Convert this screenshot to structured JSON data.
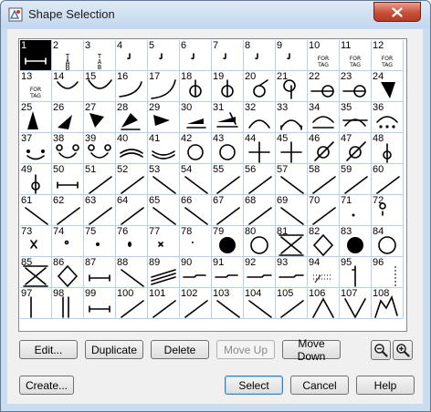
{
  "window": {
    "title": "Shape Selection",
    "close_icon": "close-icon",
    "app_icon": "shape-app-icon"
  },
  "shape_grid": {
    "selected_index": 0,
    "cells": [
      {
        "n": "1",
        "icon": "bar-end-caps"
      },
      {
        "n": "2",
        "icon": "text-tab"
      },
      {
        "n": "3",
        "icon": "text-tab-small"
      },
      {
        "n": "4",
        "icon": "small-note-tick"
      },
      {
        "n": "5",
        "icon": "small-note-tick"
      },
      {
        "n": "6",
        "icon": "small-note-tick"
      },
      {
        "n": "7",
        "icon": "small-note-tick"
      },
      {
        "n": "8",
        "icon": "small-note-tick"
      },
      {
        "n": "9",
        "icon": "small-note-tick"
      },
      {
        "n": "10",
        "icon": "for-tag-text"
      },
      {
        "n": "11",
        "icon": "for-tag-text"
      },
      {
        "n": "12",
        "icon": "for-tag-text"
      },
      {
        "n": "13",
        "icon": "for-tag-text"
      },
      {
        "n": "14",
        "icon": "arc-down-small"
      },
      {
        "n": "15",
        "icon": "arc-down-wide"
      },
      {
        "n": "16",
        "icon": "arc-quarter-left"
      },
      {
        "n": "17",
        "icon": "arc-quarter-right"
      },
      {
        "n": "18",
        "icon": "circle-stem"
      },
      {
        "n": "19",
        "icon": "circle-stem"
      },
      {
        "n": "20",
        "icon": "circle-stem-right"
      },
      {
        "n": "21",
        "icon": "circle-stem-down"
      },
      {
        "n": "22",
        "icon": "circle-line-left"
      },
      {
        "n": "23",
        "icon": "circle-line-left"
      },
      {
        "n": "24",
        "icon": "triangle-down"
      },
      {
        "n": "25",
        "icon": "triangle-up"
      },
      {
        "n": "26",
        "icon": "triangle-right"
      },
      {
        "n": "27",
        "icon": "triangle-down-right"
      },
      {
        "n": "28",
        "icon": "triangle-flag"
      },
      {
        "n": "29",
        "icon": "triangle-flag-right"
      },
      {
        "n": "30",
        "icon": "wedge-lines"
      },
      {
        "n": "31",
        "icon": "wedge-lines-slash"
      },
      {
        "n": "32",
        "icon": "arc-up"
      },
      {
        "n": "33",
        "icon": "arc-up-lines"
      },
      {
        "n": "34",
        "icon": "arc-up-underline"
      },
      {
        "n": "35",
        "icon": "arc-up-strike"
      },
      {
        "n": "36",
        "icon": "arc-dots"
      },
      {
        "n": "37",
        "icon": "smile-dots"
      },
      {
        "n": "38",
        "icon": "smile-dots-circles"
      },
      {
        "n": "39",
        "icon": "smile-dots-circles"
      },
      {
        "n": "40",
        "icon": "double-arc"
      },
      {
        "n": "41",
        "icon": "double-arc-open"
      },
      {
        "n": "42",
        "icon": "ring"
      },
      {
        "n": "43",
        "icon": "ring"
      },
      {
        "n": "44",
        "icon": "plus"
      },
      {
        "n": "45",
        "icon": "plus"
      },
      {
        "n": "46",
        "icon": "circle-slash"
      },
      {
        "n": "47",
        "icon": "circle-slash"
      },
      {
        "n": "48",
        "icon": "circle-stem-vertical"
      },
      {
        "n": "49",
        "icon": "circle-stem-vertical"
      },
      {
        "n": "50",
        "icon": "bar-end-caps"
      },
      {
        "n": "51",
        "icon": "diagonal-line"
      },
      {
        "n": "52",
        "icon": "diagonal-line"
      },
      {
        "n": "53",
        "icon": "diagonal-line-rev"
      },
      {
        "n": "54",
        "icon": "diagonal-line-rev"
      },
      {
        "n": "55",
        "icon": "diagonal-line"
      },
      {
        "n": "56",
        "icon": "diagonal-line"
      },
      {
        "n": "57",
        "icon": "diagonal-line-rev"
      },
      {
        "n": "58",
        "icon": "diagonal-line"
      },
      {
        "n": "59",
        "icon": "diagonal-line"
      },
      {
        "n": "60",
        "icon": "diagonal-line"
      },
      {
        "n": "61",
        "icon": "diagonal-line-rev"
      },
      {
        "n": "62",
        "icon": "diagonal-line"
      },
      {
        "n": "63",
        "icon": "diagonal-line"
      },
      {
        "n": "64",
        "icon": "diagonal-line"
      },
      {
        "n": "65",
        "icon": "diagonal-line-rev"
      },
      {
        "n": "66",
        "icon": "diagonal-line-rev"
      },
      {
        "n": "67",
        "icon": "diagonal-line"
      },
      {
        "n": "68",
        "icon": "diagonal-line"
      },
      {
        "n": "69",
        "icon": "diagonal-line-rev"
      },
      {
        "n": "70",
        "icon": "diagonal-line"
      },
      {
        "n": "71",
        "icon": "small-dot-mark"
      },
      {
        "n": "72",
        "icon": "small-circle-mark"
      },
      {
        "n": "73",
        "icon": "small-x-mark"
      },
      {
        "n": "74",
        "icon": "tiny-circle-mark"
      },
      {
        "n": "75",
        "icon": "dot-mark"
      },
      {
        "n": "76",
        "icon": "oval-mark"
      },
      {
        "n": "77",
        "icon": "tiny-x-mark"
      },
      {
        "n": "78",
        "icon": "tiny-dot-mark"
      },
      {
        "n": "79",
        "icon": "filled-circle"
      },
      {
        "n": "80",
        "icon": "open-circle"
      },
      {
        "n": "81",
        "icon": "boxed-x"
      },
      {
        "n": "82",
        "icon": "diamond"
      },
      {
        "n": "83",
        "icon": "filled-circle"
      },
      {
        "n": "84",
        "icon": "open-circle"
      },
      {
        "n": "85",
        "icon": "boxed-x"
      },
      {
        "n": "86",
        "icon": "diamond"
      },
      {
        "n": "87",
        "icon": "bar-end-caps"
      },
      {
        "n": "88",
        "icon": "diagonal-line-rev"
      },
      {
        "n": "89",
        "icon": "hatched-lines"
      },
      {
        "n": "90",
        "icon": "step-line"
      },
      {
        "n": "91",
        "icon": "step-line"
      },
      {
        "n": "92",
        "icon": "step-line-long"
      },
      {
        "n": "93",
        "icon": "step-line-long"
      },
      {
        "n": "94",
        "icon": "dotted-lines"
      },
      {
        "n": "95",
        "icon": "vertical-line-tick"
      },
      {
        "n": "96",
        "icon": "dashed-vertical-line"
      },
      {
        "n": "97",
        "icon": "vertical-bar"
      },
      {
        "n": "98",
        "icon": "double-vertical-bar"
      },
      {
        "n": "99",
        "icon": "bar-end-caps"
      },
      {
        "n": "100",
        "icon": "diagonal-line"
      },
      {
        "n": "101",
        "icon": "diagonal-line"
      },
      {
        "n": "102",
        "icon": "diagonal-line"
      },
      {
        "n": "103",
        "icon": "diagonal-line-rev"
      },
      {
        "n": "104",
        "icon": "diagonal-line-rev"
      },
      {
        "n": "105",
        "icon": "diagonal-line"
      },
      {
        "n": "106",
        "icon": "caret-up"
      },
      {
        "n": "107",
        "icon": "caret-down"
      },
      {
        "n": "108",
        "icon": "zigzag"
      }
    ]
  },
  "buttons": {
    "edit": "Edit...",
    "duplicate": "Duplicate",
    "delete": "Delete",
    "move_up": "Move Up",
    "move_down": "Move Down",
    "create": "Create...",
    "select": "Select",
    "cancel": "Cancel",
    "help": "Help"
  },
  "zoom": {
    "zoom_out_icon": "zoom-out-icon",
    "zoom_in_icon": "zoom-in-icon"
  }
}
